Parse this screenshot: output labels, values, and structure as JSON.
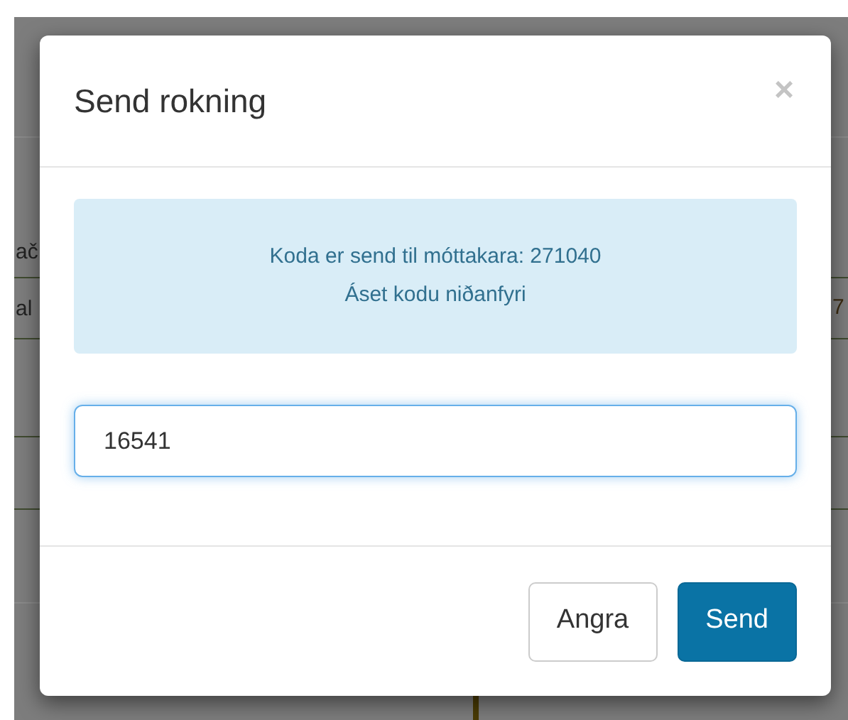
{
  "background": {
    "texts": [
      "ač",
      "al",
      "7"
    ]
  },
  "dialog": {
    "title": "Send rokning",
    "close": "×",
    "alert": {
      "lines": [
        "Koda er send til móttakara: 271040",
        "Áset kodu niðanfyri"
      ]
    },
    "code_field": {
      "value": "16541"
    },
    "buttons": [
      {
        "label": "Angra",
        "kind": "secondary"
      },
      {
        "label": "Send",
        "kind": "primary"
      }
    ]
  }
}
